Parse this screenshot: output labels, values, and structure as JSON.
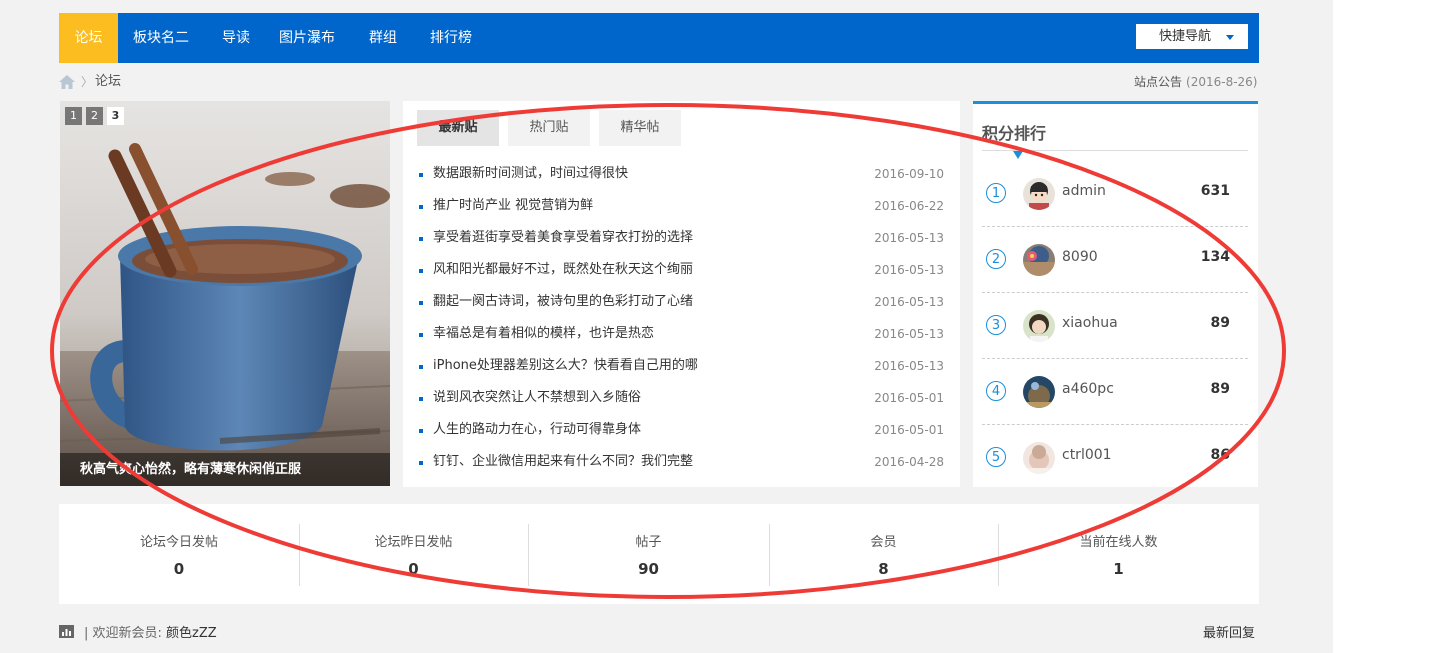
{
  "nav": {
    "items": [
      "论坛",
      "板块名二",
      "导读",
      "图片瀑布",
      "群组",
      "排行榜"
    ],
    "quick_nav": "快捷导航",
    "colors": {
      "bar": "#0066cc",
      "active": "#fbbd1f"
    }
  },
  "breadcrumb": {
    "current": "论坛",
    "notice": "站点公告",
    "notice_date": "(2016-8-26)"
  },
  "slider": {
    "pages": [
      "1",
      "2",
      "3"
    ],
    "active_page": 3,
    "caption": "秋高气爽心怡然，略有薄寒休闲俏正服"
  },
  "posts": {
    "tabs": [
      "最新贴",
      "热门贴",
      "精华帖"
    ],
    "items": [
      {
        "title": "数据跟新时间测试，时间过得很快",
        "date": "2016-09-10"
      },
      {
        "title": "推广时尚产业 视觉营销为鲜",
        "date": "2016-06-22"
      },
      {
        "title": "享受着逛街享受着美食享受着穿衣打扮的选择",
        "date": "2016-05-13"
      },
      {
        "title": "风和阳光都最好不过，既然处在秋天这个绚丽",
        "date": "2016-05-13"
      },
      {
        "title": "翻起一阕古诗词，被诗句里的色彩打动了心绪",
        "date": "2016-05-13"
      },
      {
        "title": "幸福总是有着相似的模样，也许是热恋",
        "date": "2016-05-13"
      },
      {
        "title": "iPhone处理器差别这么大？快看看自己用的哪",
        "date": "2016-05-13"
      },
      {
        "title": "说到风衣突然让人不禁想到入乡随俗",
        "date": "2016-05-01"
      },
      {
        "title": "人生的路动力在心，行动可得靠身体",
        "date": "2016-05-01"
      },
      {
        "title": "钉钉、企业微信用起来有什么不同？我们完整",
        "date": "2016-04-28"
      }
    ]
  },
  "ranking": {
    "title": "积分排行",
    "rows": [
      {
        "no": "①",
        "name": "admin",
        "score": "631"
      },
      {
        "no": "②",
        "name": "8090",
        "score": "134"
      },
      {
        "no": "③",
        "name": "xiaohua",
        "score": "89"
      },
      {
        "no": "④",
        "name": "a460pc",
        "score": "89"
      },
      {
        "no": "⑤",
        "name": "ctrl001",
        "score": "86"
      }
    ]
  },
  "stats": [
    {
      "label": "论坛今日发帖",
      "value": "0"
    },
    {
      "label": "论坛昨日发帖",
      "value": "0"
    },
    {
      "label": "帖子",
      "value": "90"
    },
    {
      "label": "会员",
      "value": "8"
    },
    {
      "label": "当前在线人数",
      "value": "1"
    }
  ],
  "footer": {
    "welcome": "| 欢迎新会员:",
    "member": "颜色zZZ",
    "latest_reply": "最新回复",
    "icon": "chart-icon"
  }
}
